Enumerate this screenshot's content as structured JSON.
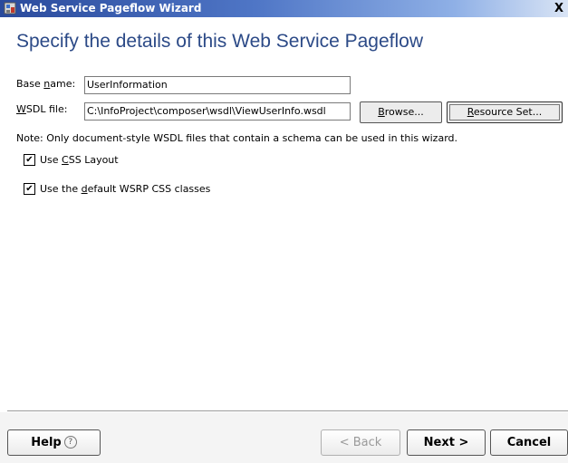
{
  "window": {
    "title": "Web Service Pageflow Wizard",
    "close_glyph": "X"
  },
  "heading": "Specify the details of this Web Service Pageflow",
  "fields": {
    "base_name": {
      "label_prefix": "Base ",
      "label_mnemonic": "n",
      "label_suffix": "ame:",
      "value": "UserInformation"
    },
    "wsdl_file": {
      "label_mnemonic": "W",
      "label_suffix": "SDL file:",
      "value": "C:\\InfoProject\\composer\\wsdl\\ViewUserInfo.wsdl"
    }
  },
  "buttons": {
    "browse": {
      "mnemonic": "B",
      "rest": "rowse..."
    },
    "resource_set": {
      "mnemonic": "R",
      "rest": "esource Set..."
    }
  },
  "note": "Note: Only document-style WSDL files that contain a schema can be used in this wizard.",
  "options": {
    "css_layout": {
      "checked": true,
      "check_glyph": "✔",
      "prefix": "Use ",
      "mnemonic": "C",
      "suffix": "SS Layout"
    },
    "wsrp_classes": {
      "checked": true,
      "check_glyph": "✔",
      "prefix": "Use the ",
      "mnemonic": "d",
      "suffix": "efault WSRP CSS classes"
    }
  },
  "footer": {
    "help_label": "Help",
    "help_glyph": "?",
    "back_label": "< Back",
    "back_enabled": false,
    "next_label": "Next >",
    "cancel_label": "Cancel"
  },
  "colors": {
    "heading": "#2c4a87",
    "titlebar_start": "#2a4a9c"
  },
  "icons": {
    "app": "wizard-app-icon",
    "close": "close-icon",
    "help": "help-circle-icon",
    "check": "checkmark-icon"
  }
}
